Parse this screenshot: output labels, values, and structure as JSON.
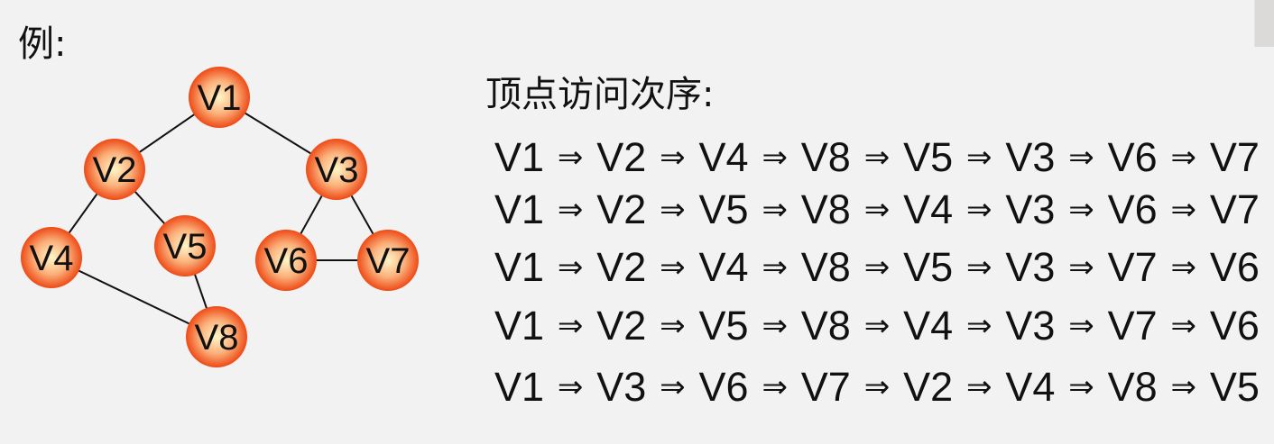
{
  "example_label": "例:",
  "order_title": "顶点访问次序:",
  "colors": {
    "node_edge": "#ee4a16",
    "node_center": "#fff6c8",
    "edge": "#111111",
    "background": "#f2f2f2"
  },
  "graph": {
    "nodes": [
      "V1",
      "V2",
      "V3",
      "V4",
      "V5",
      "V6",
      "V7",
      "V8"
    ],
    "edges": [
      [
        "V1",
        "V2"
      ],
      [
        "V1",
        "V3"
      ],
      [
        "V2",
        "V4"
      ],
      [
        "V2",
        "V5"
      ],
      [
        "V3",
        "V6"
      ],
      [
        "V3",
        "V7"
      ],
      [
        "V6",
        "V7"
      ],
      [
        "V4",
        "V8"
      ],
      [
        "V5",
        "V8"
      ]
    ]
  },
  "arrow": "⇒",
  "sequences": [
    [
      "V1",
      "V2",
      "V4",
      "V8",
      "V5",
      "V3",
      "V6",
      "V7"
    ],
    [
      "V1",
      "V2",
      "V5",
      "V8",
      "V4",
      "V3",
      "V6",
      "V7"
    ],
    [
      "V1",
      "V2",
      "V4",
      "V8",
      "V5",
      "V3",
      "V7",
      "V6"
    ],
    [
      "V1",
      "V2",
      "V5",
      "V8",
      "V4",
      "V3",
      "V7",
      "V6"
    ],
    [
      "V1",
      "V3",
      "V6",
      "V7",
      "V2",
      "V4",
      "V8",
      "V5"
    ]
  ]
}
